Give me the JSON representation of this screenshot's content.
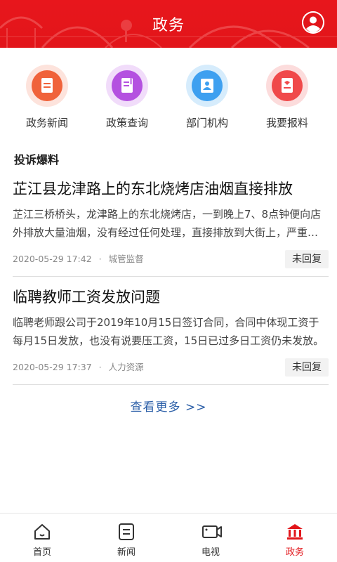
{
  "header": {
    "title": "政务"
  },
  "colors": {
    "brand": "#e2151a",
    "link": "#2c5fa8",
    "active_tab": "#e2151a"
  },
  "quick_links": [
    {
      "label": "政务新闻",
      "icon": "news-document-icon",
      "color": "#f0623a"
    },
    {
      "label": "政策查询",
      "icon": "policy-book-icon",
      "color": "#b451e0"
    },
    {
      "label": "部门机构",
      "icon": "department-badge-icon",
      "color": "#3ea0f0"
    },
    {
      "label": "我要报料",
      "icon": "report-card-icon",
      "color": "#f0494a"
    }
  ],
  "section_title": "投诉爆料",
  "items": [
    {
      "title": "芷江县龙津路上的东北烧烤店油烟直接排放",
      "summary": "芷江三桥桥头，龙津路上的东北烧烤店，一到晚上7、8点钟便向店外排放大量油烟，没有经过任何处理，直接排放到大街上，严重影响过往行人。",
      "time": "2020-05-29 17:42",
      "category": "城管监督",
      "status": "未回复"
    },
    {
      "title": "临聘教师工资发放问题",
      "summary": "临聘老师跟公司于2019年10月15日签订合同，合同中体现工资于每月15日发放，也没有说要压工资，15日已过多日工资仍未发放。",
      "time": "2020-05-29 17:37",
      "category": "人力资源",
      "status": "未回复"
    }
  ],
  "more_link": "查看更多 >>",
  "nav": [
    {
      "label": "首页",
      "icon": "home-icon",
      "active": false
    },
    {
      "label": "新闻",
      "icon": "news-icon",
      "active": false
    },
    {
      "label": "电视",
      "icon": "tv-camera-icon",
      "active": false
    },
    {
      "label": "政务",
      "icon": "government-building-icon",
      "active": true
    }
  ],
  "meta_separator": "·"
}
